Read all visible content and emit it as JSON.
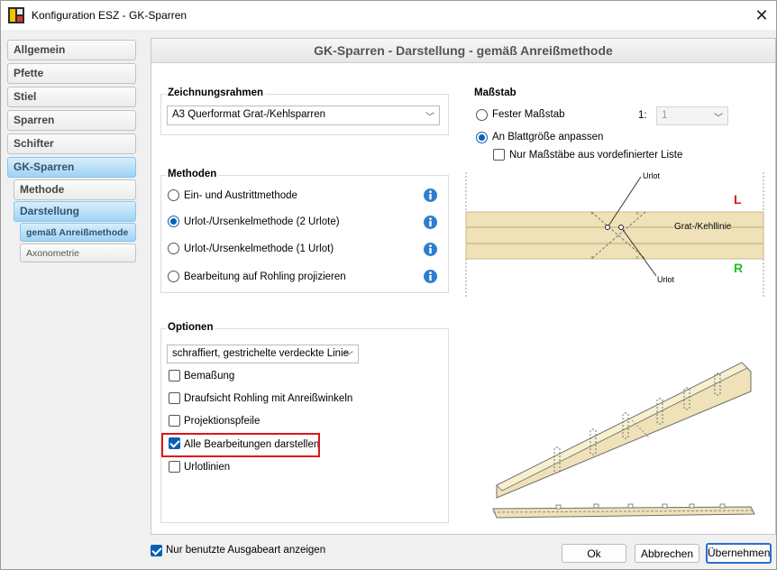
{
  "window": {
    "title": "Konfiguration ESZ - GK-Sparren"
  },
  "nav": {
    "items": [
      {
        "label": "Allgemein"
      },
      {
        "label": "Pfette"
      },
      {
        "label": "Stiel"
      },
      {
        "label": "Sparren"
      },
      {
        "label": "Schifter"
      },
      {
        "label": "GK-Sparren"
      },
      {
        "label": "Methode"
      },
      {
        "label": "Darstellung"
      },
      {
        "label": "gemäß Anreißmethode"
      },
      {
        "label": "Axonometrie"
      }
    ]
  },
  "panel": {
    "header": "GK-Sparren - Darstellung -  gemäß Anreißmethode"
  },
  "zeichnungsrahmen": {
    "title": "Zeichnungsrahmen",
    "value": "A3 Querformat Grat-/Kehlsparren"
  },
  "massstab": {
    "title": "Maßstab",
    "fester": "Fester Maßstab",
    "ratio_prefix": "1:",
    "ratio_value": "1",
    "anpassen": "An Blattgröße anpassen",
    "nur_liste": "Nur Maßstäbe aus vordefinierter Liste"
  },
  "methoden": {
    "title": "Methoden",
    "options": [
      {
        "label": "Ein- und Austrittmethode",
        "checked": false
      },
      {
        "label": "Urlot-/Ursenkelmethode (2 Urlote)",
        "checked": true
      },
      {
        "label": "Urlot-/Ursenkelmethode (1 Urlot)",
        "checked": false
      },
      {
        "label": "Bearbeitung auf Rohling projizieren",
        "checked": false
      }
    ]
  },
  "diagram": {
    "urlot_top": "Urlot",
    "urlot_bottom": "Urlot",
    "line_label": "Grat-/Kehllinie",
    "left_marker": "L",
    "right_marker": "R",
    "left_color": "#e01010",
    "right_color": "#22c022"
  },
  "optionen": {
    "title": "Optionen",
    "style_value": "schraffiert, gestrichelte verdeckte Linie",
    "checks": [
      {
        "label": "Bemaßung",
        "checked": false
      },
      {
        "label": "Draufsicht Rohling mit Anreißwinkeln",
        "checked": false
      },
      {
        "label": "Projektionspfeile",
        "checked": false
      },
      {
        "label": "Alle Bearbeitungen darstellen",
        "checked": true
      },
      {
        "label": "Urlotlinien",
        "checked": false
      }
    ]
  },
  "footer": {
    "nur_benutzte": "Nur benutzte Ausgabeart anzeigen",
    "ok": "Ok",
    "abbrechen": "Abbrechen",
    "uebernehmen": "Übernehmen"
  },
  "colors": {
    "accent": "#0a5fb4",
    "highlight": "#e0141e",
    "nav_active": "#9fd3f5",
    "beam": "#efe2b8"
  }
}
